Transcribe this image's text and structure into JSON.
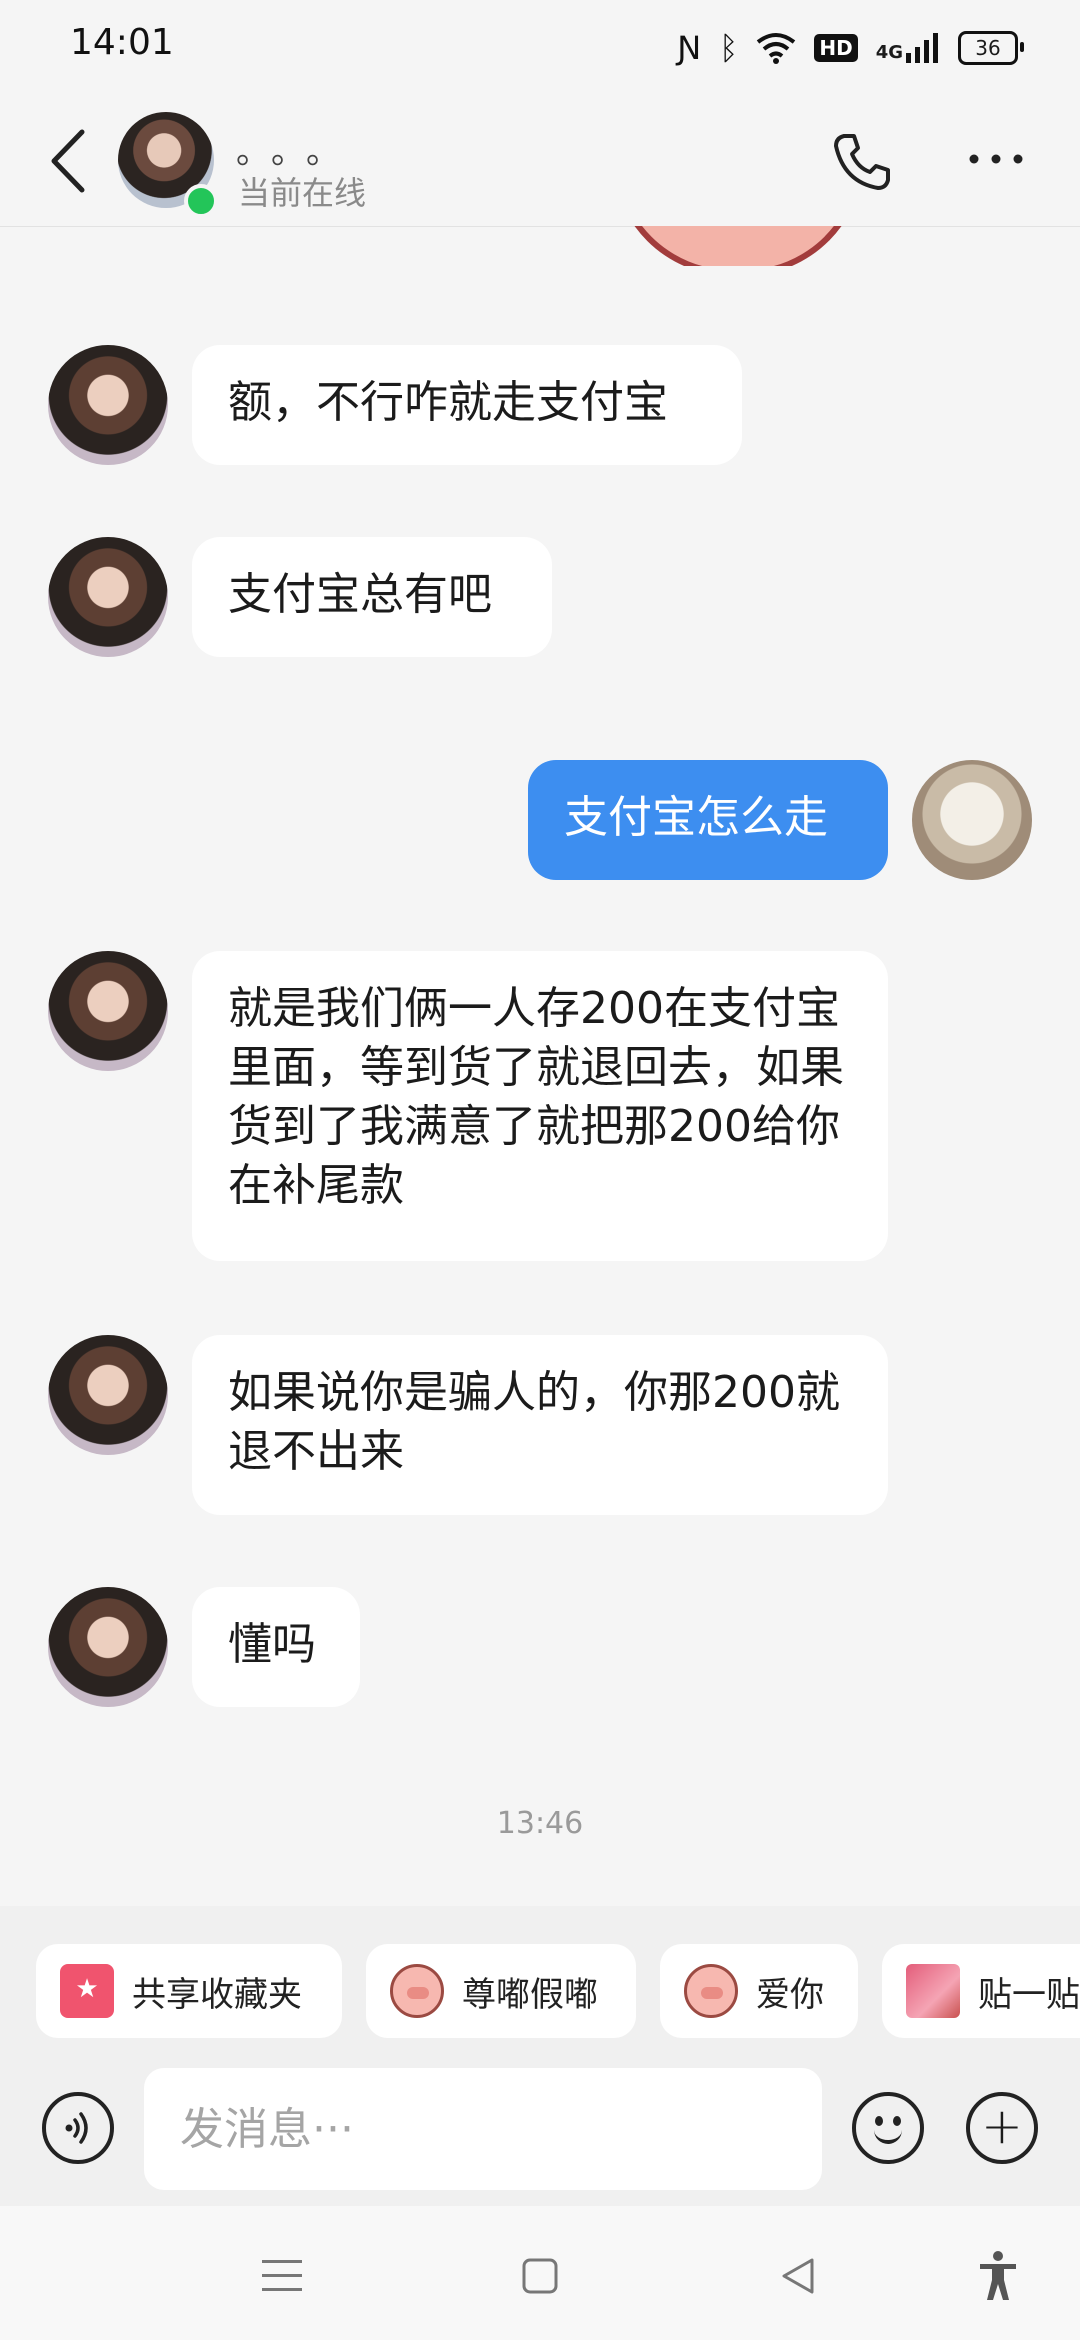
{
  "status_bar": {
    "time": "14:01",
    "icons": [
      "nfc-icon",
      "bluetooth-icon",
      "wifi-icon",
      "hd-icon",
      "signal-4g-icon",
      "battery-icon"
    ],
    "hd_label": "HD",
    "network_label": "4G",
    "battery_level": "36"
  },
  "header": {
    "contact_name": "。。。",
    "online_status": "当前在线",
    "online_color": "#23c559"
  },
  "messages": [
    {
      "from": "them",
      "text": "额，不行咋就走支付宝"
    },
    {
      "from": "them",
      "text": "支付宝总有吧"
    },
    {
      "from": "me",
      "text": "支付宝怎么走"
    },
    {
      "from": "them",
      "text": "就是我们俩一人存200在支付宝里面，等到货了就退回去，如果货到了我满意了就把那200给你在补尾款"
    },
    {
      "from": "them",
      "text": "如果说你是骗人的，你那200就退不出来"
    },
    {
      "from": "them",
      "text": "懂吗"
    }
  ],
  "timestamp": "13:46",
  "quick_chips": [
    {
      "label": "共享收藏夹",
      "icon": "folder-star-icon"
    },
    {
      "label": "尊嘟假嘟",
      "icon": "pig-face-icon"
    },
    {
      "label": "爱你",
      "icon": "pig-love-icon"
    },
    {
      "label": "贴一贴",
      "icon": "sticker-photo-icon"
    }
  ],
  "input": {
    "placeholder": "发消息···"
  },
  "colors": {
    "outgoing_bubble": "#3d8ef0",
    "incoming_bubble": "#ffffff",
    "background": "#f5f5f5"
  }
}
